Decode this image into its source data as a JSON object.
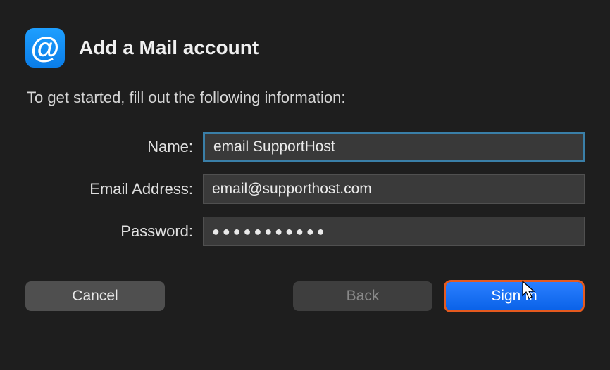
{
  "header": {
    "icon_glyph": "@",
    "title": "Add a Mail account"
  },
  "subtitle": "To get started, fill out the following information:",
  "form": {
    "name": {
      "label": "Name:",
      "value": "email SupportHost"
    },
    "email": {
      "label": "Email Address:",
      "value": "email@supporthost.com"
    },
    "password": {
      "label": "Password:",
      "value_masked": "●●●●●●●●●●●"
    }
  },
  "buttons": {
    "cancel": "Cancel",
    "back": "Back",
    "signin": "Sign In"
  }
}
